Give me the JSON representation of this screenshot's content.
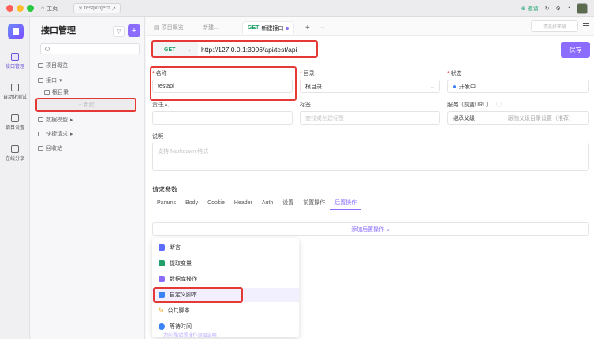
{
  "titlebar": {
    "home": "主页",
    "project": "testproject",
    "invite": "邀请"
  },
  "nav": [
    {
      "label": "接口管理",
      "icon": "api-icon"
    },
    {
      "label": "自动化测试",
      "icon": "auto-test-icon"
    },
    {
      "label": "项目设置",
      "icon": "settings-icon"
    },
    {
      "label": "在线分享",
      "icon": "share-icon"
    }
  ],
  "sidebar": {
    "title": "接口管理",
    "tree": {
      "overview": "项目概览",
      "api": "接口",
      "root": "根目录",
      "new": "+ 新建",
      "models": "数据模型",
      "requests": "快捷请求",
      "trash": "回收站"
    }
  },
  "tabs": {
    "t1": "项目概览",
    "t2": "新建...",
    "t3_method": "GET",
    "t3_label": "新建接口",
    "env": "请选择环境"
  },
  "request": {
    "method": "GET",
    "url": "http://127.0.0.1:3006/api/test/api",
    "save": "保存"
  },
  "form": {
    "name_label": "名称",
    "name_value": "testapi",
    "dir_label": "目录",
    "dir_value": "根目录",
    "status_label": "状态",
    "status_value": "开发中",
    "owner_label": "责任人",
    "tag_label": "标签",
    "tag_placeholder": "查找或创建标签",
    "service_label": "服务（前置URL）",
    "service_value": "继承父级",
    "service_hint": "跟随父级目录设置（推荐）",
    "desc_label": "说明",
    "desc_placeholder": "支持 Markdown 格式"
  },
  "params": {
    "title": "请求参数",
    "tabs": [
      "Params",
      "Body",
      "Cookie",
      "Header",
      "Auth",
      "设置",
      "前置操作",
      "后置操作"
    ],
    "add_post": "添加后置操作 ⌄"
  },
  "dropdown": [
    {
      "label": "断言",
      "color": "#5b6cff"
    },
    {
      "label": "提取变量",
      "color": "#22a06b"
    },
    {
      "label": "数据库操作",
      "color": "#8b6cff"
    },
    {
      "label": "自定义脚本",
      "color": "#3b82f6"
    },
    {
      "label": "公共脚本",
      "color": "#f59e0b"
    },
    {
      "label": "等待时间",
      "color": "#3b82f6"
    }
  ],
  "bottom_hint": "为前置/后置操作添加说明"
}
